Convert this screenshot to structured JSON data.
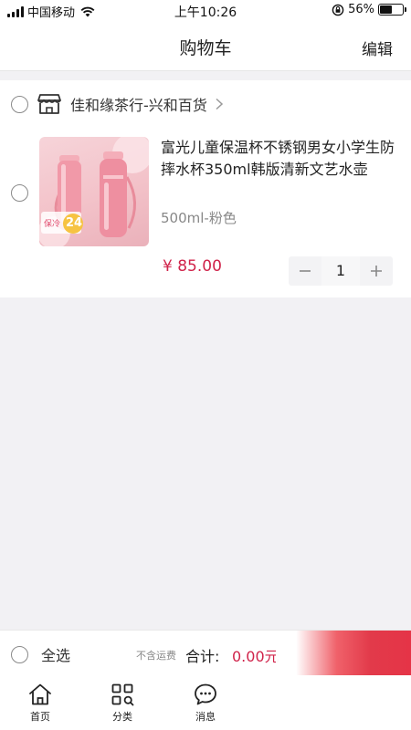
{
  "status_bar": {
    "carrier": "中国移动",
    "time": "上午10:26",
    "battery": "56%",
    "battery_level": 0.56
  },
  "nav": {
    "title": "购物车",
    "edit_label": "编辑"
  },
  "cart": {
    "shop": {
      "name": "佳和缘茶行-兴和百货",
      "selected": false
    },
    "items": [
      {
        "title": "富光儿童保温杯不锈钢男女小学生防摔水杯350ml韩版清新文艺水壶",
        "spec": "500ml-粉色",
        "price": "¥ 85.00",
        "quantity": "1",
        "image_badge": "保冷",
        "image_badge_number": "24",
        "selected": false
      }
    ]
  },
  "checkout": {
    "select_all_label": "全选",
    "shipping_note": "不含运费",
    "total_label": "合计:",
    "total_value": "0.00元"
  },
  "tabs": [
    {
      "label": "首页",
      "icon": "home-icon"
    },
    {
      "label": "分类",
      "icon": "category-icon"
    },
    {
      "label": "消息",
      "icon": "message-icon"
    }
  ],
  "colors": {
    "accent": "#d0234a",
    "background": "#f2f1f4",
    "checkout_gradient_end": "#e53447"
  }
}
